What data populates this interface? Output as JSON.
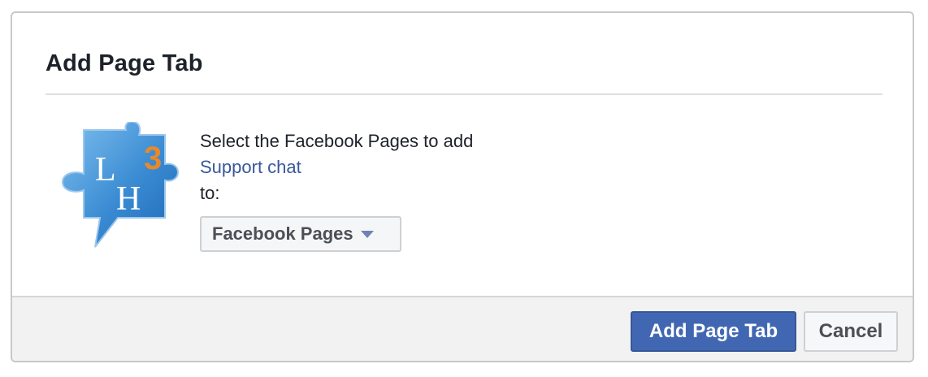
{
  "dialog": {
    "title": "Add Page Tab"
  },
  "app": {
    "logo_icon": "lh3-puzzle-chat-logo-icon",
    "logo_text": "LH3"
  },
  "body": {
    "line1": "Select the Facebook Pages to add",
    "app_link": "Support chat",
    "line3": "to:"
  },
  "selector": {
    "value": "Facebook Pages",
    "icon": "caret-down-icon"
  },
  "footer": {
    "primary_label": "Add Page Tab",
    "cancel_label": "Cancel"
  },
  "colors": {
    "primary": "#4267b2",
    "link": "#385898",
    "logo_blue": "#3f8fd6",
    "logo_orange": "#e6892d"
  }
}
